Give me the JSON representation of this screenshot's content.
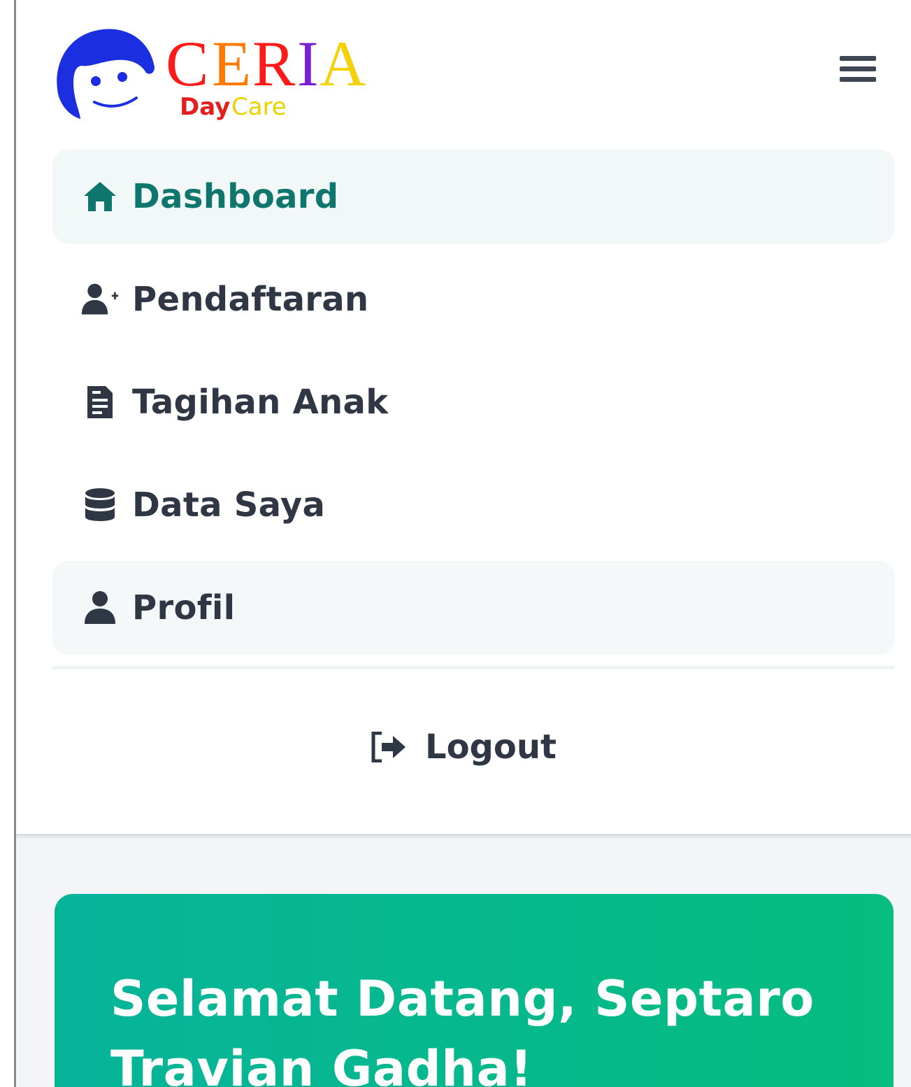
{
  "brand": {
    "letters": [
      "C",
      "E",
      "R",
      "I",
      "A"
    ],
    "letter_colors": [
      "#ff1a1a",
      "#ff7a00",
      "#ff1a1a",
      "#7a1fd1",
      "#f4d20a"
    ],
    "tagline_part1": "Day",
    "tagline_part2": "Care",
    "tagline_color1": "#e51f1f",
    "tagline_color2": "#e8d300",
    "mascot_color": "#1b2fe0"
  },
  "header": {
    "menu_icon": "hamburger-menu-icon"
  },
  "sidebar": {
    "items": [
      {
        "label": "Dashboard",
        "icon": "home-icon",
        "active": true
      },
      {
        "label": "Pendaftaran",
        "icon": "user-plus-icon",
        "active": false
      },
      {
        "label": "Tagihan Anak",
        "icon": "document-icon",
        "active": false
      },
      {
        "label": "Data Saya",
        "icon": "database-icon",
        "active": false
      },
      {
        "label": "Profil",
        "icon": "user-icon",
        "active": false,
        "highlighted": true
      }
    ],
    "logout": {
      "label": "Logout",
      "icon": "logout-icon"
    }
  },
  "main": {
    "welcome": "Selamat Datang, Septaro Travian Gadha!"
  },
  "colors": {
    "accent": "#0f766e",
    "text": "#2f3744",
    "card_gradient_start": "#06b49a",
    "card_gradient_end": "#07bd7f"
  }
}
